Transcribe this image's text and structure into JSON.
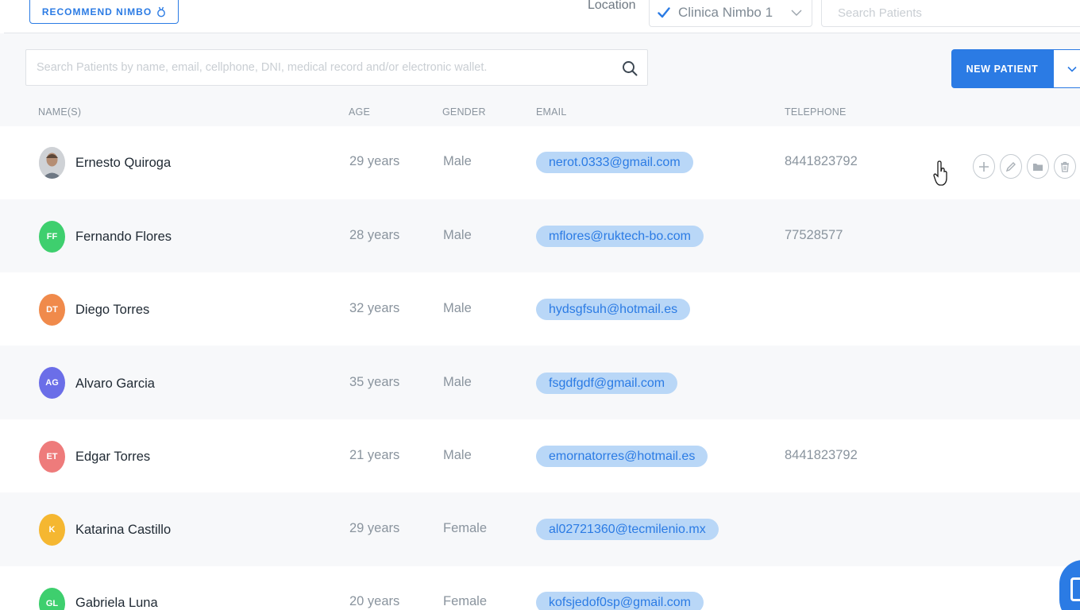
{
  "topbar": {
    "recommend_label": "RECOMMEND NIMBO",
    "location_label": "Location",
    "location_value": "Clinica Nimbo 1",
    "search_placeholder": "Search Patients"
  },
  "search": {
    "placeholder": "Search Patients by name, email, cellphone, DNI, medical record and/or electronic wallet."
  },
  "actions": {
    "new_patient_label": "NEW PATIENT"
  },
  "table": {
    "headers": {
      "name": "NAME(S)",
      "age": "AGE",
      "gender": "GENDER",
      "email": "EMAIL",
      "telephone": "TELEPHONE"
    },
    "rows": [
      {
        "initials": "",
        "name": "Ernesto Quiroga",
        "age": "29 years",
        "gender": "Male",
        "email": "nerot.0333@gmail.com",
        "telephone": "8441823792",
        "color": "#d9dadc"
      },
      {
        "initials": "FF",
        "name": "Fernando Flores",
        "age": "28 years",
        "gender": "Male",
        "email": "mflores@ruktech-bo.com",
        "telephone": "77528577",
        "color": "#3ecf6e"
      },
      {
        "initials": "DT",
        "name": "Diego Torres",
        "age": "32 years",
        "gender": "Male",
        "email": "hydsgfsuh@hotmail.es",
        "telephone": "",
        "color": "#f08a4b"
      },
      {
        "initials": "AG",
        "name": "Alvaro Garcia",
        "age": "35 years",
        "gender": "Male",
        "email": "fsgdfgdf@gmail.com",
        "telephone": "",
        "color": "#6b6ee8"
      },
      {
        "initials": "ET",
        "name": "Edgar Torres",
        "age": "21 years",
        "gender": "Male",
        "email": "emornatorres@hotmail.es",
        "telephone": "8441823792",
        "color": "#ee7b7b"
      },
      {
        "initials": "K",
        "name": "Katarina Castillo",
        "age": "29 years",
        "gender": "Female",
        "email": "al02721360@tecmilenio.mx",
        "telephone": "",
        "color": "#f5b731"
      },
      {
        "initials": "GL",
        "name": "Gabriela Luna",
        "age": "20 years",
        "gender": "Female",
        "email": "kofsjedof0sp@gmail.com",
        "telephone": "",
        "color": "#3ecf6e"
      }
    ]
  },
  "colors": {
    "accent": "#2b7be4",
    "pill_bg": "#b9d7f7"
  },
  "icons": {
    "recommend": "medal-icon",
    "location_check": "check-icon",
    "location_chevron": "chevron-down-icon",
    "search": "search-icon",
    "row_actions": [
      "add-icon",
      "edit-icon",
      "folder-icon",
      "trash-icon"
    ],
    "chat": "chat-icon"
  }
}
